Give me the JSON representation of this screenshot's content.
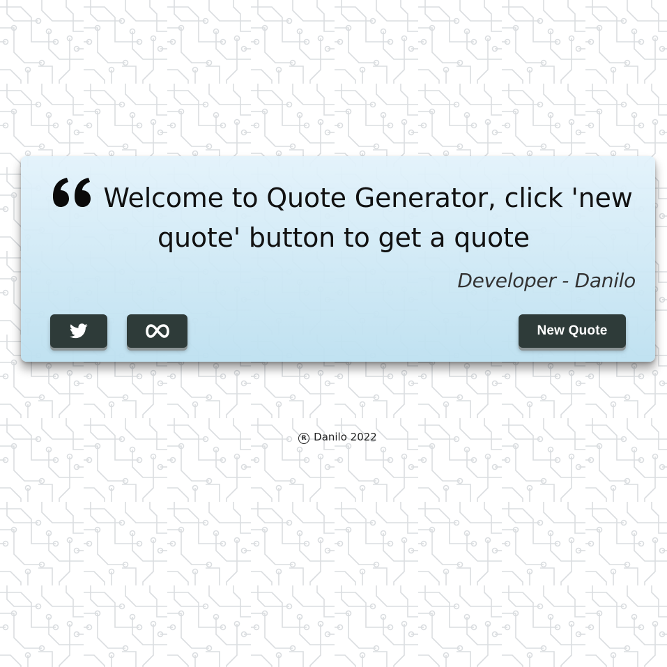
{
  "colors": {
    "card_top": "#e2f2fb",
    "card_bottom": "#bde0f0",
    "button_bg": "#2e3b39",
    "button_text": "#ffffff",
    "circuit_line": "#dadde0"
  },
  "quote": {
    "line1": "Welcome to Quote Generator, click 'new",
    "line2": "quote' button to get a quote",
    "author": "Developer - Danilo",
    "icon": "quote-left-icon"
  },
  "buttons": {
    "twitter": {
      "icon": "twitter-icon"
    },
    "meta": {
      "icon": "meta-icon"
    },
    "new_quote": {
      "label": "New Quote"
    }
  },
  "footer": {
    "icon": "registered-icon",
    "text": "Danilo 2022"
  }
}
